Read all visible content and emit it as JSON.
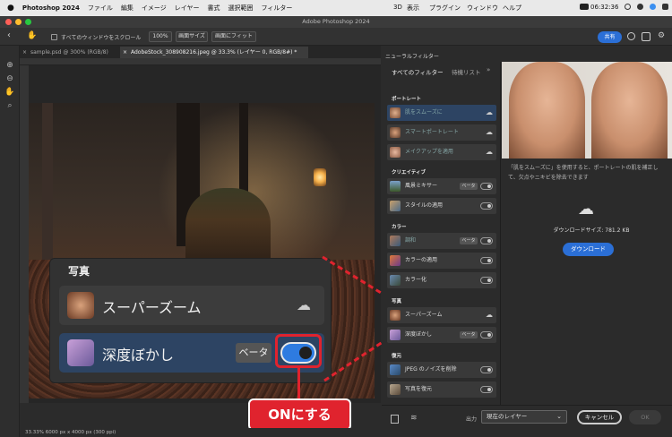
{
  "menubar": {
    "apple": "",
    "app": "Photoshop 2024",
    "items": [
      "ファイル",
      "編集",
      "イメージ",
      "レイヤー",
      "書式",
      "選択範囲",
      "フィルター"
    ],
    "right": [
      "3D",
      "表示",
      "プラグイン",
      "ウィンドウ",
      "ヘルプ"
    ],
    "clock": "06:32:36"
  },
  "window": {
    "title": "Adobe Photoshop 2024"
  },
  "options": {
    "scroll_all": "すべてのウィンドウをスクロール",
    "zoom": "100%",
    "fit_screen": "画面サイズ",
    "fill_screen": "画面にフィット",
    "share": "共有"
  },
  "tabs": [
    {
      "label": "sample.psd @ 300% (RGB/8)"
    },
    {
      "label": "AdobeStock_308908216.jpeg @ 33.3% (レイヤー 0, RGB/8#) *"
    }
  ],
  "status": {
    "text": "33.33%    6000 px x 4000 px (300 ppi)"
  },
  "callout": {
    "title": "写真",
    "item1": "スーパーズーム",
    "item2": "深度ぼかし",
    "beta": "ベータ"
  },
  "annotation": {
    "label": "ONにする"
  },
  "panel": {
    "tab_title": "ニューラルフィルター",
    "sub_all": "すべてのフィルター",
    "sub_wait": "待機リスト",
    "categories": {
      "portrait": "ポートレート",
      "creative": "クリエイティブ",
      "color": "カラー",
      "photo": "写真",
      "restore": "復元"
    },
    "items": {
      "skin": "肌をスムーズに",
      "smart_portrait": "スマートポートレート",
      "makeup": "メイクアップを適用",
      "landscape": "風景ミキサー",
      "style": "スタイルの適用",
      "harmony": "調和",
      "color_transfer": "カラーの適用",
      "colorize": "カラー化",
      "superzoom": "スーパーズーム",
      "depth_blur": "深度ぼかし",
      "jpeg_noise": "JPEG のノイズを削除",
      "photo_restore": "写真を復元"
    },
    "beta": "ベータ",
    "description": "「肌をスムーズに」を使用すると、ポートレートの肌を補正して、欠点やニキビを除去できます",
    "download_size": "ダウンロードサイズ: 781.2 KB",
    "download_button": "ダウンロード",
    "output_label": "出力",
    "output_value": "現在のレイヤー",
    "cancel": "キャンセル",
    "ok": "OK"
  },
  "colors": {
    "accent": "#2b6fd6",
    "annotation": "#e0232e",
    "selected": "#2d4463"
  }
}
